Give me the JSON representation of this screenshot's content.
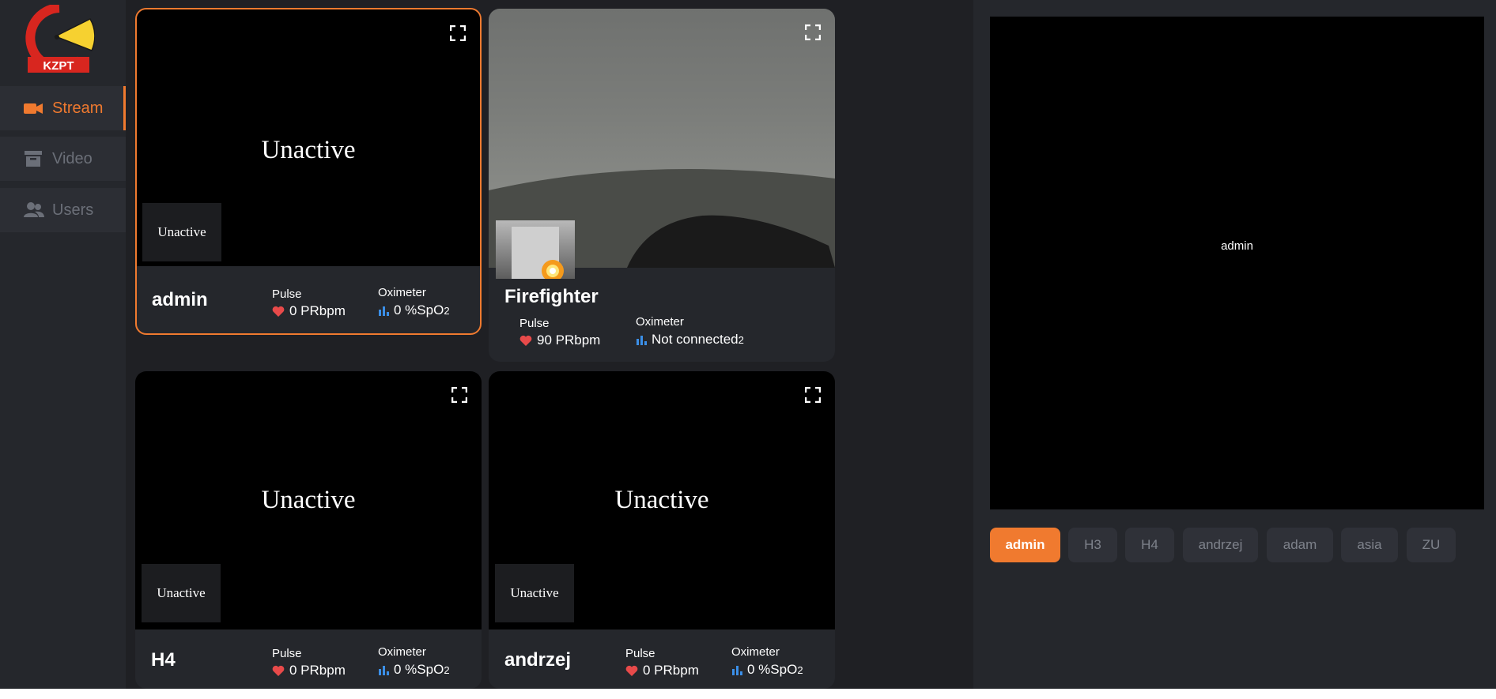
{
  "brand": {
    "logo_text": "KZPT",
    "accent_color": "#f07a2f"
  },
  "sidebar": {
    "items": [
      {
        "label": "Stream",
        "icon": "camera-icon",
        "active": true
      },
      {
        "label": "Video",
        "icon": "archive-icon",
        "active": false
      },
      {
        "label": "Users",
        "icon": "users-icon",
        "active": false
      }
    ]
  },
  "cards": [
    {
      "name": "admin",
      "main_status": "Unactive",
      "thumb_status": "Unactive",
      "selected": true,
      "pulse_title": "Pulse",
      "pulse_value": "0 PRbpm",
      "oxi_title": "Oximeter",
      "oxi_value": "0 %SpO",
      "oxi_sub": "2"
    },
    {
      "name": "Firefighter",
      "main_status": "",
      "thumb_status": "",
      "selected": false,
      "pulse_title": "Pulse",
      "pulse_value": "90 PRbpm",
      "oxi_title": "Oximeter",
      "oxi_value": "Not connected",
      "oxi_sub": "2"
    },
    {
      "name": "H4",
      "main_status": "Unactive",
      "thumb_status": "Unactive",
      "selected": false,
      "pulse_title": "Pulse",
      "pulse_value": "0 PRbpm",
      "oxi_title": "Oximeter",
      "oxi_value": "0 %SpO",
      "oxi_sub": "2"
    },
    {
      "name": "andrzej",
      "main_status": "Unactive",
      "thumb_status": "Unactive",
      "selected": false,
      "pulse_title": "Pulse",
      "pulse_value": "0 PRbpm",
      "oxi_title": "Oximeter",
      "oxi_value": "0 %SpO",
      "oxi_sub": "2"
    }
  ],
  "preview": {
    "label": "admin"
  },
  "user_buttons": [
    {
      "label": "admin",
      "active": true
    },
    {
      "label": "H3",
      "active": false
    },
    {
      "label": "H4",
      "active": false
    },
    {
      "label": "andrzej",
      "active": false
    },
    {
      "label": "adam",
      "active": false
    },
    {
      "label": "asia",
      "active": false
    },
    {
      "label": "ZU",
      "active": false
    }
  ],
  "colors": {
    "heart": "#e84a4a",
    "bars": "#3b8fe8",
    "background": "#1f2024",
    "panel": "#25272c"
  }
}
